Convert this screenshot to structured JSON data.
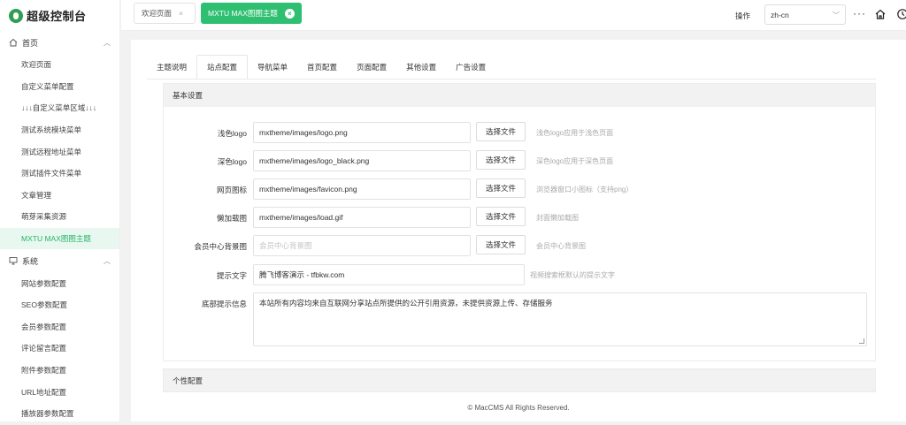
{
  "app": {
    "title": "超级控制台"
  },
  "sidebar": {
    "groups": [
      {
        "label": "首页",
        "icon": "home-icon",
        "items": [
          "欢迎页面",
          "自定义菜单配置",
          "↓↓↓自定义菜单区域↓↓↓",
          "测试系统模块菜单",
          "测试远程地址菜单",
          "测试插件文件菜单",
          "文章管理",
          "萌芽采集资源",
          "MXTU MAX图图主题"
        ]
      },
      {
        "label": "系统",
        "icon": "monitor-icon",
        "items": [
          "网站参数配置",
          "SEO参数配置",
          "会员参数配置",
          "评论留言配置",
          "附件参数配置",
          "URL地址配置",
          "播放器参数配置"
        ]
      }
    ],
    "active_item": "MXTU MAX图图主题"
  },
  "topbar": {
    "tabs": [
      {
        "label": "欢迎页面"
      },
      {
        "label": "MXTU MAX图图主题"
      }
    ],
    "operation_label": "操作",
    "language": "zh-cn",
    "more": "···"
  },
  "subtabs": [
    "主题说明",
    "站点配置",
    "导航菜单",
    "首页配置",
    "页面配置",
    "其他设置",
    "广告设置"
  ],
  "basic": {
    "title": "基本设置",
    "fields": [
      {
        "label": "浅色logo",
        "value": "mxtheme/images/logo.png",
        "button": "选择文件",
        "hint": "浅色logo应用于浅色页面"
      },
      {
        "label": "深色logo",
        "value": "mxtheme/images/logo_black.png",
        "button": "选择文件",
        "hint": "深色logo应用于深色页面"
      },
      {
        "label": "网页图标",
        "value": "mxtheme/images/favicon.png",
        "button": "选择文件",
        "hint": "浏览器窗口小图标（支持png）"
      },
      {
        "label": "懒加载图",
        "value": "mxtheme/images/load.gif",
        "button": "选择文件",
        "hint": "封面懒加载图"
      },
      {
        "label": "会员中心背景图",
        "placeholder": "会员中心背景图",
        "button": "选择文件",
        "hint": "会员中心背景图"
      }
    ],
    "tip": {
      "label": "提示文字",
      "value": "腾飞博客演示 - tfbkw.com",
      "hint": "视频搜索框默认的提示文字"
    },
    "footer_tip": {
      "label": "底部提示信息",
      "value": "本站所有内容均来自互联网分享站点所提供的公开引用资源，未提供资源上传、存储服务"
    }
  },
  "personal": {
    "title": "个性配置"
  },
  "footer": "© MacCMS All Rights Reserved.",
  "colors": {
    "accent": "#2fbf71",
    "active_bg": "#e8f7ef"
  }
}
